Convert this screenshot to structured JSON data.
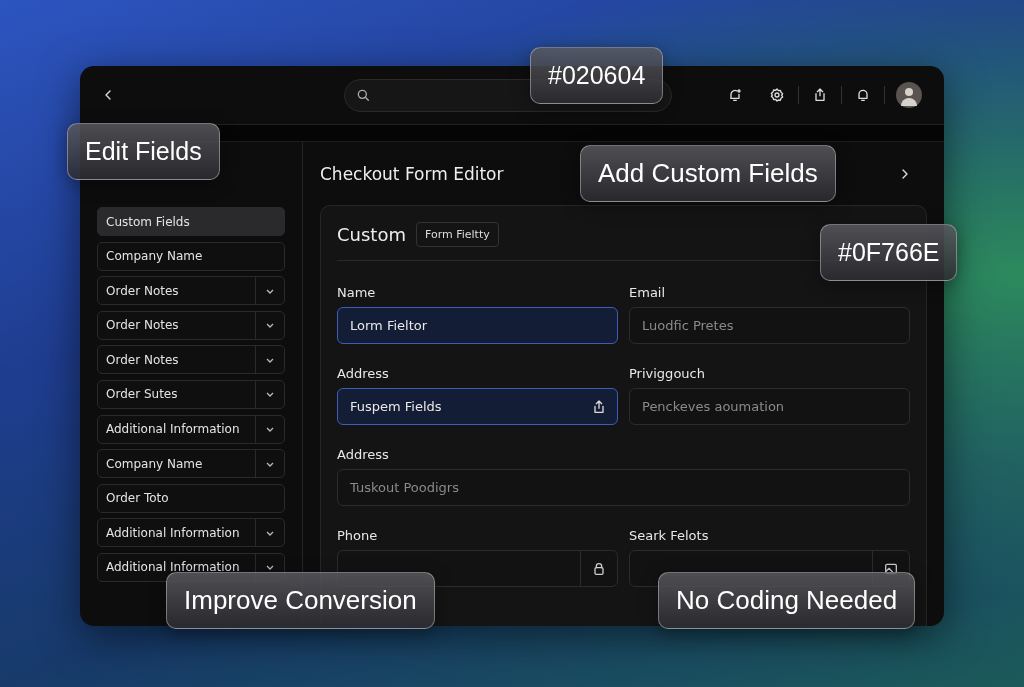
{
  "topbar": {
    "avatar": {
      "kind": "person"
    }
  },
  "sidebar": {
    "items": [
      {
        "label": "Custom Fields",
        "selected": true,
        "kind": "plain"
      },
      {
        "label": "Company Name",
        "selected": false,
        "kind": "plain"
      },
      {
        "label": "Order Notes",
        "selected": false,
        "kind": "dropdown"
      },
      {
        "label": "Order Notes",
        "selected": false,
        "kind": "dropdown"
      },
      {
        "label": "Order Notes",
        "selected": false,
        "kind": "dropdown"
      },
      {
        "label": "Order Sutes",
        "selected": false,
        "kind": "dropdown"
      },
      {
        "label": "Additional Information",
        "selected": false,
        "kind": "dropdown"
      },
      {
        "label": "Company Name",
        "selected": false,
        "kind": "dropdown"
      },
      {
        "label": "Order Toto",
        "selected": false,
        "kind": "plain"
      },
      {
        "label": "Additional Information",
        "selected": false,
        "kind": "dropdown"
      },
      {
        "label": "Additional Information",
        "selected": false,
        "kind": "dropdown"
      }
    ]
  },
  "main": {
    "title": "Checkout Form Editor",
    "card": {
      "title": "Custom",
      "chip": "Form Fieltty",
      "rows": [
        [
          {
            "label": "Name",
            "value": "Lorm Fieltor",
            "highlighted": true,
            "kind": "plain"
          },
          {
            "label": "Email",
            "placeholder": "Luodfic Pretes",
            "highlighted": false,
            "kind": "plain"
          }
        ],
        [
          {
            "label": "Address",
            "value": "Fuspem Fields",
            "highlighted": true,
            "kind": "upload"
          },
          {
            "label": "Priviggouch",
            "placeholder": "Penckeves aoumation",
            "highlighted": false,
            "kind": "plain"
          }
        ],
        [
          {
            "label": "Address",
            "placeholder": "Tuskout Poodigrs",
            "highlighted": false,
            "kind": "plain"
          }
        ],
        [
          {
            "label": "Phone",
            "highlighted": false,
            "kind": "locked"
          },
          {
            "label": "Seark Felots",
            "highlighted": false,
            "kind": "media"
          }
        ]
      ]
    }
  },
  "callouts": [
    {
      "text": "#020604"
    },
    {
      "text": "Edit Fields"
    },
    {
      "text": "Add Custom Fields"
    },
    {
      "text": "#0F766E"
    },
    {
      "text": "Improve Conversion"
    },
    {
      "text": "No Coding Needed"
    }
  ]
}
